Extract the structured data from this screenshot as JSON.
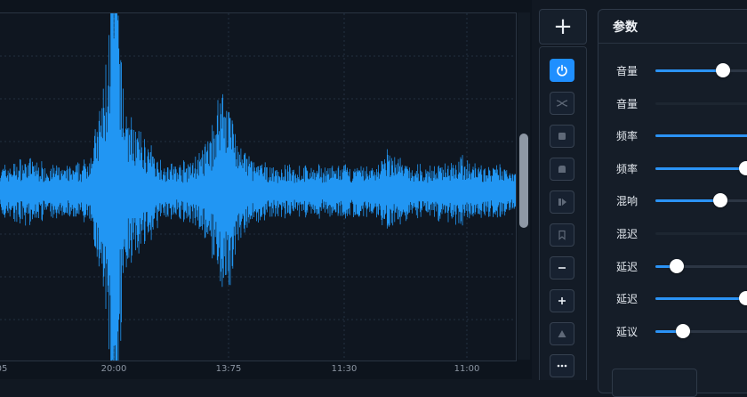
{
  "waveform": {
    "time_labels": [
      "05",
      "20:00",
      "13:75",
      "11:30",
      "11:00"
    ],
    "color": "#2196f3",
    "grid_color": "#233040"
  },
  "tools": {
    "add_label": "+",
    "buttons": [
      {
        "icon": "power-icon",
        "state": "active"
      },
      {
        "icon": "crossfade-icon",
        "state": "disabled"
      },
      {
        "icon": "clip-icon",
        "state": "disabled"
      },
      {
        "icon": "blob-icon",
        "state": "disabled"
      },
      {
        "icon": "play-next-icon",
        "state": "disabled"
      },
      {
        "icon": "bookmark-icon",
        "state": "disabled"
      },
      {
        "icon": "minus-icon",
        "state": "enabled"
      },
      {
        "icon": "plus-icon",
        "state": "enabled"
      },
      {
        "icon": "triangle-icon",
        "state": "disabled"
      },
      {
        "icon": "more-icon",
        "state": "enabled"
      }
    ]
  },
  "params": {
    "title": "参数",
    "sliders": [
      {
        "label": "音量",
        "value": 0.69,
        "has_thumb": true
      },
      {
        "label": "音量",
        "value": 0.0,
        "has_thumb": false
      },
      {
        "label": "频率",
        "value": 1.0,
        "has_thumb": false
      },
      {
        "label": "频率",
        "value": 0.93,
        "has_thumb": true
      },
      {
        "label": "混响",
        "value": 0.66,
        "has_thumb": true
      },
      {
        "label": "混迟",
        "value": 0.0,
        "has_thumb": false
      },
      {
        "label": "延迟",
        "value": 0.22,
        "has_thumb": true
      },
      {
        "label": "延迟",
        "value": 0.93,
        "has_thumb": true
      },
      {
        "label": "延议",
        "value": 0.28,
        "has_thumb": true
      }
    ],
    "accent": "#2b93f5"
  }
}
